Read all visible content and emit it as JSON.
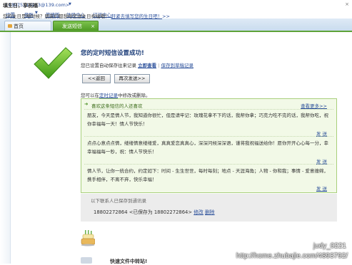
{
  "account": {
    "email": "<13975113253@139.com>",
    "dropdown_glyph": "▼"
  },
  "topnav": {
    "items": [
      "设置",
      "换肤",
      "简捷版",
      "体验中心",
      "订阅中心"
    ],
    "dropdown_glyph": "▼"
  },
  "tabs": {
    "home": "首页",
    "sms": "发送短信",
    "close": "×"
  },
  "success": {
    "title": "您的定时短信设置成功!",
    "desc": "您已设置自动保存往来记录",
    "view_now": "立即查看",
    "sep": "|",
    "save_draft": "保存到草稿记录",
    "back_button": "<<返回",
    "resend_button": "再次发送>>"
  },
  "hint": {
    "pre": "您可以在",
    "link": "定时记录",
    "post": "中修改或删除。"
  },
  "panel": {
    "header": "喜欢这条短信的人还喜欢",
    "more": "查看更多>>",
    "messages": [
      {
        "text": "朋友，今天是情人节，我知道你很忙，但是请牢记：玫瑰花拿不下的话，我帮你拿；巧克力吃不完的话，我帮你吃，祝你幸福每一天！情人节快乐！",
        "send": "发 送"
      },
      {
        "text": "点点心意点点情，缕缕情意缕缕爱，真真爱恋真真心，深深问候深深语，谨将我祝福送给你！愿你开开心心每一分，幸幸福福每一秒，祝：情人节快乐！",
        "send": "发 送"
      },
      {
        "text": "情人节，让你一统合约，约定如下：时间 - 生生世世，每时每刻；地点 - 天涯海角；人物 - 你和我；事情 - 爱意缠绵，携手相伴，不离不弃，快乐幸福！",
        "send": "发 送"
      }
    ]
  },
  "contacts": {
    "heading": "以下联系人已保存到通讯录",
    "number": "18802272864",
    "saved_as": "<已保存为",
    "saved_number": "18802272864>",
    "edit": "修改",
    "delete": "删除"
  },
  "birthday": {
    "title": "填生日，享祝福",
    "text": "您的生日是啥时候？朋友们都想给您送生日祝福哦！",
    "link": "赶紧去填写您的生日吧！",
    "link_arrow": ">>",
    "close": "×"
  },
  "bottom": {
    "title": "快速文件中转站!"
  },
  "watermark": {
    "user": "judy_0221",
    "url": "http://home.zhubajie.com/4893792/"
  },
  "colors": {
    "accent_green": "#5ea338",
    "link_blue": "#2a4f9a",
    "title_blue": "#1e3f7a"
  }
}
